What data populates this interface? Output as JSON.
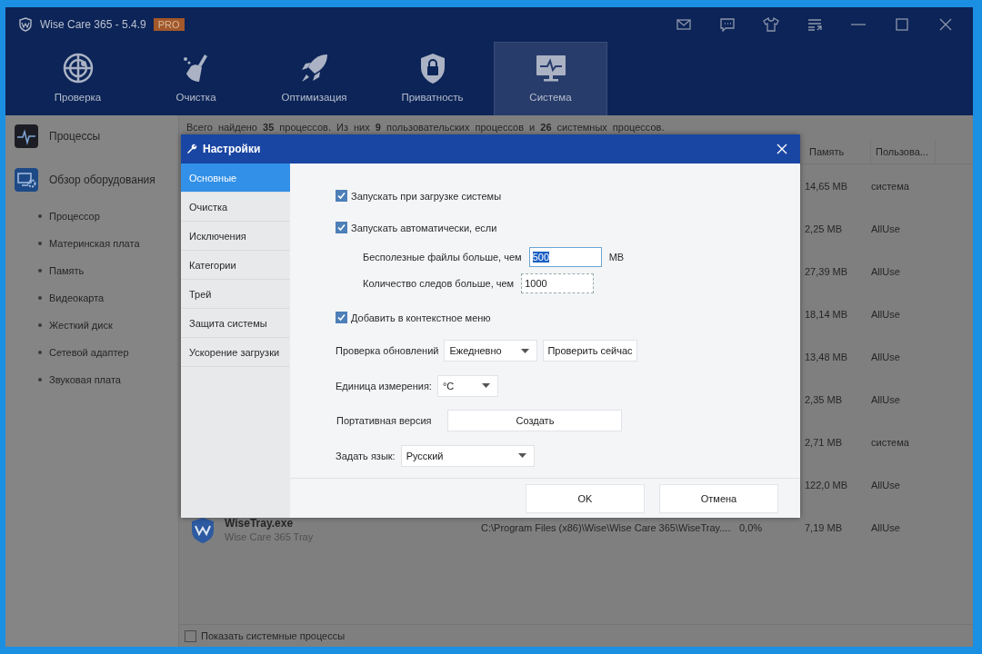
{
  "window": {
    "title": "Wise Care 365 - 5.4.9",
    "badge": "PRO"
  },
  "nav_tabs": [
    {
      "label": "Проверка",
      "kind": "radar",
      "selected": false
    },
    {
      "label": "Очистка",
      "kind": "broom",
      "selected": false
    },
    {
      "label": "Оптимизация",
      "kind": "rocket",
      "selected": false
    },
    {
      "label": "Приватность",
      "kind": "shield",
      "selected": false
    },
    {
      "label": "Система",
      "kind": "monitor",
      "selected": true
    }
  ],
  "sidebar": {
    "items": [
      {
        "label": "Процессы",
        "kind": "process"
      },
      {
        "label": "Обзор оборудования",
        "kind": "hardware",
        "children": [
          {
            "label": "Процессор"
          },
          {
            "label": "Материнская плата"
          },
          {
            "label": "Память"
          },
          {
            "label": "Видеокарта"
          },
          {
            "label": "Жесткий диск"
          },
          {
            "label": "Сетевой адаптер"
          },
          {
            "label": "Звуковая плата"
          }
        ]
      }
    ]
  },
  "summary": "Всего найдено **35** процессов. Из них **9** пользовательских процессов и **26** системных процессов.",
  "table": {
    "columns": [
      "Память",
      "Пользова..."
    ],
    "rows": [
      {
        "memory": "14,65 MB",
        "user": "система"
      },
      {
        "memory": "2,25 MB",
        "user": "AllUse"
      },
      {
        "memory": "27,39 MB",
        "user": "AllUse"
      },
      {
        "memory": "18,14 MB",
        "user": "AllUse"
      },
      {
        "memory": "13,48 MB",
        "user": "AllUse"
      },
      {
        "memory": "2,35 MB",
        "user": "AllUse"
      },
      {
        "memory": "2,71 MB",
        "user": "система"
      },
      {
        "memory": "122,0 MB",
        "user": "AllUse"
      },
      {
        "name": "WiseTray.exe",
        "description": "Wise Care 365 Tray",
        "path": "C:\\Program Files (x86)\\Wise\\Wise Care 365\\WiseTray....",
        "cpu": "0,0%",
        "memory": "7,19 MB",
        "user": "AllUse"
      }
    ]
  },
  "show_system_processes": {
    "label": "Показать системные процессы",
    "checked": false
  },
  "dialog": {
    "title": "Настройки",
    "nav": [
      {
        "label": "Основные",
        "selected": true
      },
      {
        "label": "Очистка",
        "selected": false
      },
      {
        "label": "Исключения",
        "selected": false
      },
      {
        "label": "Категории",
        "selected": false
      },
      {
        "label": "Трей",
        "selected": false
      },
      {
        "label": "Защита системы",
        "selected": false
      },
      {
        "label": "Ускорение загрузки",
        "selected": false
      }
    ],
    "options": [
      {
        "kind": "checkbox",
        "label": "Запускать при загрузке системы",
        "checked": true
      },
      {
        "kind": "checkbox",
        "label": "Запускать автоматически, если",
        "checked": true
      },
      {
        "kind": "field",
        "label": "Бесполезные файлы больше, чем",
        "value": "500",
        "unit": "MB",
        "focused": true
      },
      {
        "kind": "field",
        "label": "Количество следов больше, чем",
        "value": "1000",
        "focused": false
      },
      {
        "kind": "checkbox",
        "label": "Добавить в контекстное меню",
        "checked": true
      },
      {
        "kind": "select",
        "label": "Проверка обновлений",
        "value": "Ежедневно",
        "button": "Проверить сейчас"
      },
      {
        "kind": "select",
        "label": "Единица измерения:",
        "value": "°C"
      },
      {
        "kind": "button",
        "label": "Портативная версия",
        "button": "Создать"
      },
      {
        "kind": "select",
        "label": "Задать язык:",
        "value": "Русский"
      }
    ],
    "buttons": [
      "OK",
      "Отмена"
    ]
  }
}
